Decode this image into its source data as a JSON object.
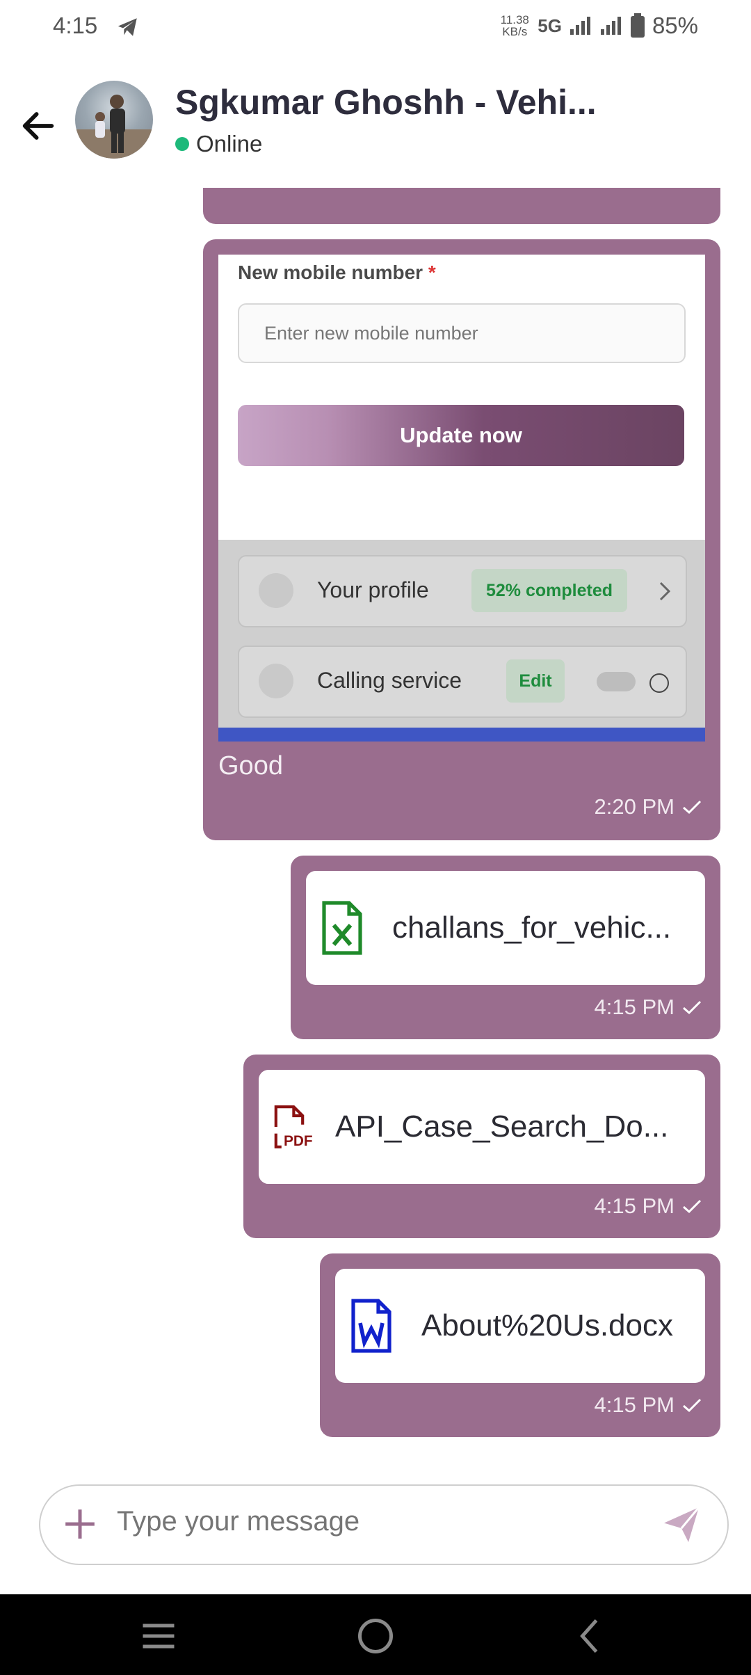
{
  "status_bar": {
    "time": "4:15",
    "speed_value": "11.38",
    "speed_unit": "KB/s",
    "network": "5G",
    "battery": "85%"
  },
  "header": {
    "contact_name": "Sgkumar Ghoshh - Vehi...",
    "presence": "Online"
  },
  "messages": {
    "image_message": {
      "screenshot": {
        "field_label": "New mobile number",
        "required_mark": "*",
        "input_placeholder": "Enter new mobile number",
        "button_label": "Update now",
        "profile_label": "Your profile",
        "profile_badge": "52% completed",
        "calling_label": "Calling service",
        "calling_badge": "Edit"
      },
      "caption": "Good",
      "time": "2:20 PM"
    },
    "file1": {
      "name": "challans_for_vehic...",
      "type_icon": "excel-file-icon",
      "time": "4:15 PM"
    },
    "file2": {
      "name": "API_Case_Search_Do...",
      "type_icon": "pdf-file-icon",
      "icon_text": "PDF",
      "time": "4:15 PM"
    },
    "file3": {
      "name": "About%20Us.docx",
      "type_icon": "word-file-icon",
      "time": "4:15 PM"
    }
  },
  "composer": {
    "placeholder": "Type your message"
  },
  "colors": {
    "bubble": "#9a6d8e",
    "accent": "#9a6d8e",
    "online": "#1db97a"
  }
}
